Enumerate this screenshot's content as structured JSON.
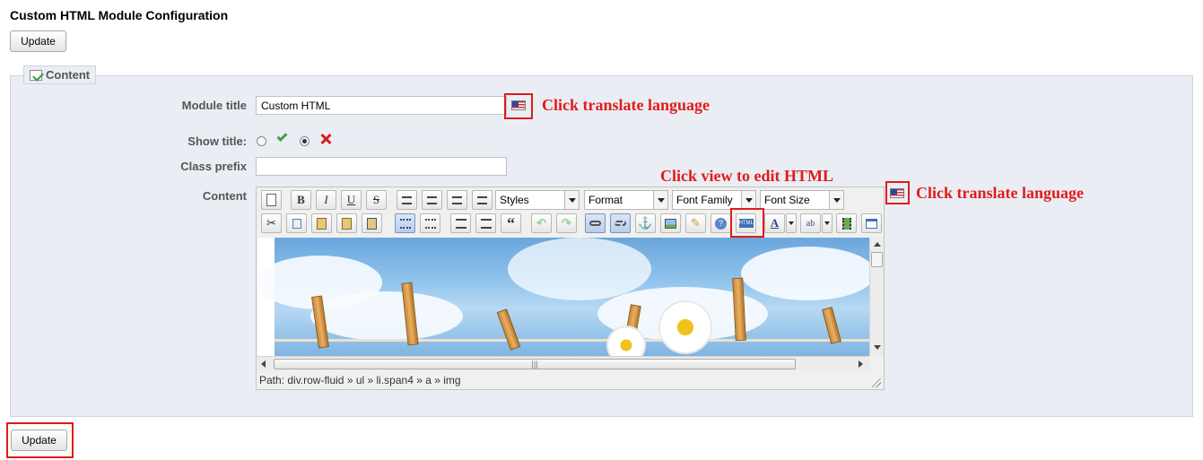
{
  "page": {
    "title": "Custom HTML Module Configuration"
  },
  "buttons": {
    "update_top": "Update",
    "update_bottom": "Update"
  },
  "fieldset": {
    "legend": "Content",
    "legend_icon": "edit-icon"
  },
  "form": {
    "module_title": {
      "label": "Module title",
      "value": "Custom HTML"
    },
    "show_title": {
      "label": "Show title:",
      "selected": "no"
    },
    "class_prefix": {
      "label": "Class prefix",
      "value": ""
    },
    "content": {
      "label": "Content"
    }
  },
  "callouts": {
    "translate_title": "Click translate language",
    "view_html": "Click view to edit HTML",
    "translate_content": "Click translate language"
  },
  "editor": {
    "selects": {
      "styles": "Styles",
      "format": "Format",
      "font_family": "Font Family",
      "font_size": "Font Size"
    },
    "html_button": "HTML",
    "path": "Path: div.row-fluid » ul » li.span4 » a » img"
  },
  "colors": {
    "accent_red": "#e01b1b",
    "panel_bg": "#ebedf4",
    "check_green": "#3fa33f"
  }
}
